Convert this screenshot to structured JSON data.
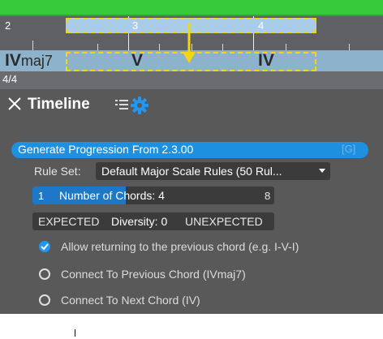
{
  "timeline": {
    "bar_numbers": [
      "2",
      "3",
      "4"
    ],
    "chords": [
      {
        "main": "IV",
        "suffix": "maj7"
      },
      {
        "main": "V",
        "suffix": ""
      },
      {
        "main": "IV",
        "suffix": ""
      }
    ],
    "time_signature": "4/4"
  },
  "panel": {
    "title": "Timeline",
    "generate_button": "Generate Progression From 2.3.00",
    "generate_shortcut": "[G]",
    "rule_set_label": "Rule Set:",
    "rule_set_value": "Default Major Scale Rules (50 Rul...",
    "chords_slider": {
      "min": "1",
      "label": "Number of Chords: 4",
      "max": "8",
      "value": 4
    },
    "diversity_slider": {
      "left": "EXPECTED",
      "label": "Diversity: 0",
      "right": "UNEXPECTED"
    },
    "options": [
      {
        "label": "Allow returning to the previous chord (e.g. I-V-I)",
        "checked": true
      },
      {
        "label": "Connect To Previous Chord (IVmaj7)",
        "checked": false
      },
      {
        "label": "Connect To Next Chord (IV)",
        "checked": false
      }
    ]
  },
  "colors": {
    "accent": "#1e90e0",
    "panel_bg": "#595959",
    "selection_border": "#f5d50f",
    "top_bar": "#36c93a"
  },
  "icons": [
    "close-icon",
    "list-icon",
    "gear-icon",
    "arrow-down-icon",
    "check-icon",
    "radio-icon"
  ]
}
